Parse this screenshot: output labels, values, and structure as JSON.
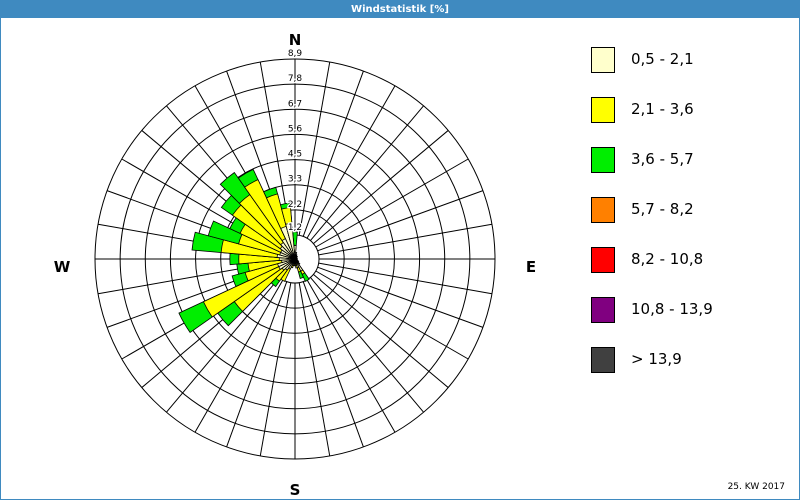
{
  "window": {
    "title": "Windstatistik [%]"
  },
  "footer": {
    "period": "25. KW 2017"
  },
  "colors": {
    "frame": "#3f8ac0",
    "grid": "#000000",
    "sea_inner_circle": "#ffffff"
  },
  "chart_data": {
    "type": "wind-rose",
    "title": "Windstatistik [%]",
    "unit": "%",
    "directions_deg": [
      0,
      10,
      20,
      30,
      40,
      50,
      60,
      70,
      80,
      90,
      100,
      110,
      120,
      130,
      140,
      150,
      160,
      170,
      180,
      190,
      200,
      210,
      220,
      230,
      240,
      250,
      260,
      270,
      280,
      290,
      300,
      310,
      320,
      330,
      340,
      350
    ],
    "compass_labels": {
      "north": "N",
      "east": "E",
      "south": "S",
      "west": "W"
    },
    "radial_ticks": [
      "1,2",
      "2,2",
      "3,3",
      "4,5",
      "5,6",
      "6,7",
      "7,8",
      "8,9"
    ],
    "r_max": 8.9,
    "speed_classes": [
      {
        "label": "0,5 - 2,1",
        "color": "#ffffcc"
      },
      {
        "label": "2,1 - 3,6",
        "color": "#ffff00"
      },
      {
        "label": "3,6 - 5,7",
        "color": "#00ee00"
      },
      {
        "label": "5,7 - 8,2",
        "color": "#ff8000"
      },
      {
        "label": "8,2 - 10,8",
        "color": "#ff0000"
      },
      {
        "label": "10,8 - 13,9",
        "color": "#800080"
      },
      {
        "label": "> 13,9",
        "color": "#404040"
      }
    ],
    "cumulative_percent": [
      [
        0.6,
        0.6,
        1.2,
        1.2,
        1.2,
        1.2,
        1.2
      ],
      [
        0.3,
        0.3,
        0.3,
        0.3,
        0.3,
        0.3,
        0.3
      ],
      [
        0.2,
        0.2,
        0.2,
        0.2,
        0.2,
        0.2,
        0.2
      ],
      [
        0.15,
        0.15,
        0.15,
        0.15,
        0.15,
        0.15,
        0.15
      ],
      [
        0.15,
        0.15,
        0.15,
        0.15,
        0.15,
        0.15,
        0.15
      ],
      [
        0.1,
        0.1,
        0.1,
        0.1,
        0.1,
        0.1,
        0.1
      ],
      [
        0.1,
        0.1,
        0.1,
        0.1,
        0.1,
        0.1,
        0.1
      ],
      [
        0.1,
        0.1,
        0.1,
        0.1,
        0.1,
        0.1,
        0.1
      ],
      [
        0.1,
        0.1,
        0.1,
        0.1,
        0.1,
        0.1,
        0.1
      ],
      [
        0.1,
        0.1,
        0.1,
        0.1,
        0.1,
        0.1,
        0.1
      ],
      [
        0.1,
        0.1,
        0.1,
        0.1,
        0.1,
        0.1,
        0.1
      ],
      [
        0.1,
        0.1,
        0.1,
        0.1,
        0.1,
        0.1,
        0.1
      ],
      [
        0.15,
        0.15,
        0.15,
        0.15,
        0.15,
        0.15,
        0.15
      ],
      [
        0.2,
        0.2,
        0.2,
        0.2,
        0.2,
        0.2,
        0.2
      ],
      [
        0.3,
        0.3,
        0.3,
        0.3,
        0.3,
        0.3,
        0.3
      ],
      [
        0.6,
        0.75,
        1.1,
        1.1,
        1.1,
        1.1,
        1.1
      ],
      [
        0.4,
        0.6,
        0.9,
        0.9,
        0.9,
        0.9,
        0.9
      ],
      [
        0.3,
        0.4,
        0.4,
        0.4,
        0.4,
        0.4,
        0.4
      ],
      [
        0.2,
        0.3,
        0.3,
        0.3,
        0.3,
        0.3,
        0.3
      ],
      [
        0.2,
        0.3,
        0.3,
        0.3,
        0.3,
        0.3,
        0.3
      ],
      [
        0.3,
        0.4,
        0.4,
        0.4,
        0.4,
        0.4,
        0.4
      ],
      [
        0.5,
        1.1,
        1.1,
        1.1,
        1.1,
        1.1,
        1.1
      ],
      [
        0.6,
        1.2,
        1.5,
        1.5,
        1.5,
        1.5,
        1.5
      ],
      [
        0.7,
        3.3,
        4.2,
        4.2,
        4.2,
        4.2,
        4.2
      ],
      [
        0.8,
        4.5,
        5.7,
        5.7,
        5.7,
        5.7,
        5.7
      ],
      [
        0.8,
        2.3,
        2.9,
        2.9,
        2.9,
        2.9,
        2.9
      ],
      [
        0.6,
        2.1,
        2.6,
        2.6,
        2.6,
        2.6,
        2.6
      ],
      [
        0.7,
        2.5,
        2.9,
        2.9,
        2.9,
        2.9,
        2.9
      ],
      [
        0.8,
        3.3,
        4.6,
        4.6,
        4.6,
        4.6,
        4.6
      ],
      [
        0.7,
        2.6,
        4.0,
        4.0,
        4.0,
        4.0,
        4.0
      ],
      [
        0.7,
        2.7,
        3.2,
        3.2,
        3.2,
        3.2,
        3.2
      ],
      [
        0.8,
        3.4,
        4.0,
        4.0,
        4.0,
        4.0,
        4.0
      ],
      [
        0.9,
        3.5,
        4.7,
        4.7,
        4.7,
        4.7,
        4.7
      ],
      [
        1.0,
        3.9,
        4.4,
        4.4,
        4.4,
        4.4,
        4.4
      ],
      [
        1.5,
        3.0,
        3.3,
        3.3,
        3.3,
        3.3,
        3.3
      ],
      [
        1.6,
        2.3,
        2.5,
        2.5,
        2.5,
        2.5,
        2.5
      ]
    ]
  }
}
